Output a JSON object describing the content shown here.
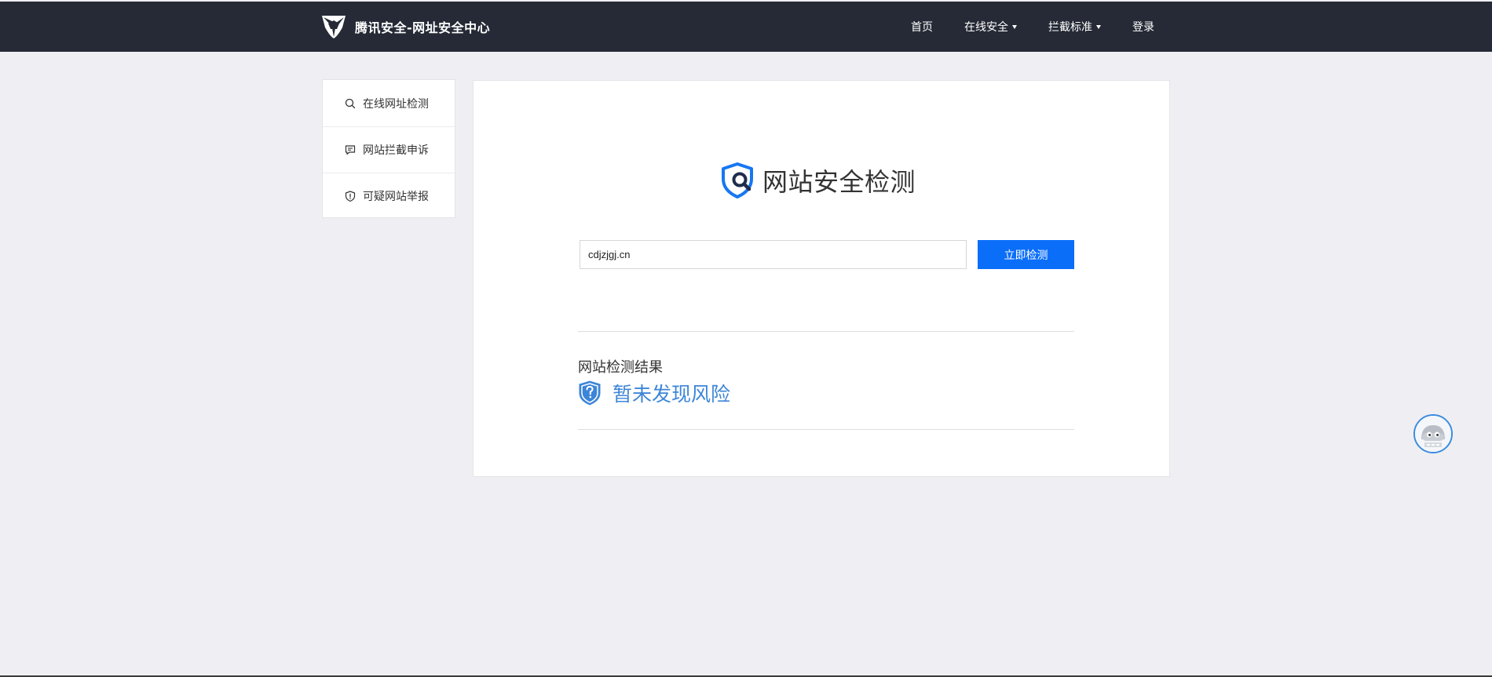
{
  "header": {
    "brand": "腾讯安全-网址安全中心",
    "nav": [
      {
        "label": "首页",
        "has_dropdown": false
      },
      {
        "label": "在线安全",
        "has_dropdown": true
      },
      {
        "label": "拦截标准",
        "has_dropdown": true
      },
      {
        "label": "登录",
        "has_dropdown": false
      }
    ]
  },
  "sidebar": {
    "items": [
      {
        "label": "在线网址检测",
        "icon": "search-icon"
      },
      {
        "label": "网站拦截申诉",
        "icon": "message-icon"
      },
      {
        "label": "可疑网站举报",
        "icon": "shield-alert-icon"
      }
    ]
  },
  "main": {
    "title": "网站安全检测",
    "search": {
      "value": "cdjzjgj.cn",
      "button_label": "立即检测"
    },
    "result": {
      "label": "网站检测结果",
      "status": "暂未发现风险"
    }
  },
  "colors": {
    "topbar": "#252a36",
    "accent": "#0a6ef9",
    "status": "#3d85d8",
    "background": "#efeff3"
  }
}
